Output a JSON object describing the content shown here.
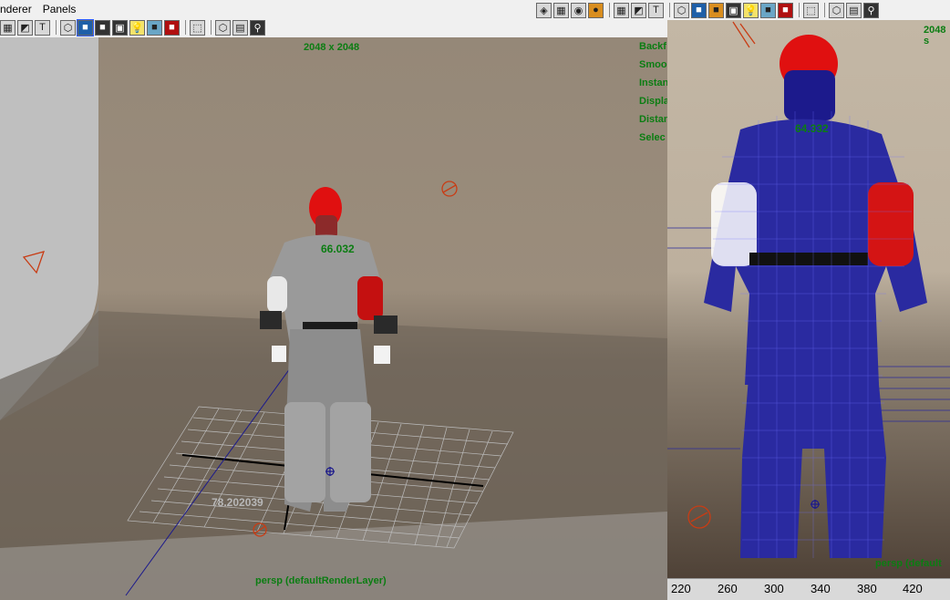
{
  "menubar": {
    "items": [
      "nderer",
      "Panels"
    ]
  },
  "left_toolbar": {
    "icons": [
      "grid-view-icon",
      "camera-view-icon",
      "text-overlay-icon",
      "wireframe-cube-icon",
      "smooth-shade-icon",
      "shaded-cube-icon",
      "textured-cube-icon",
      "light-bulb-icon",
      "xray-icon",
      "red-cube-icon",
      "select-icon",
      "isolate-icon",
      "film-gate-icon",
      "resolution-gate-icon"
    ]
  },
  "right_toolbar": {
    "icons": [
      "layers-icon",
      "grid-view-icon",
      "camera-view-icon",
      "sphere-icon",
      "grid-view-icon",
      "camera-view-icon",
      "text-overlay-icon",
      "wireframe-cube-icon",
      "shaded-cube-icon",
      "textured-cube-icon",
      "light-bulb-icon",
      "xray-icon",
      "red-cube-icon",
      "select-icon",
      "isolate-icon",
      "film-gate-icon",
      "resolution-gate-icon"
    ]
  },
  "left_viewport": {
    "resolution": "2048 x 2048",
    "hud_items": [
      "Backf",
      "Smoo",
      "Instan",
      "Displa",
      "Distan",
      "Selec"
    ],
    "distance_label": "66.032",
    "grid_label": "78.202039",
    "camera_label": "persp (defaultRenderLayer)"
  },
  "right_viewport": {
    "resolution": "2048 s",
    "distance_label": "64.332",
    "camera_label": "persp (default"
  },
  "timeline_ruler": {
    "ticks": [
      "220",
      "260",
      "300",
      "340",
      "380",
      "420"
    ]
  },
  "colors": {
    "hud_green": "#0b7d12",
    "wire_blue": "#1c1a8c",
    "highlight_red": "#e01010",
    "camera_icon": "#c83c14"
  }
}
